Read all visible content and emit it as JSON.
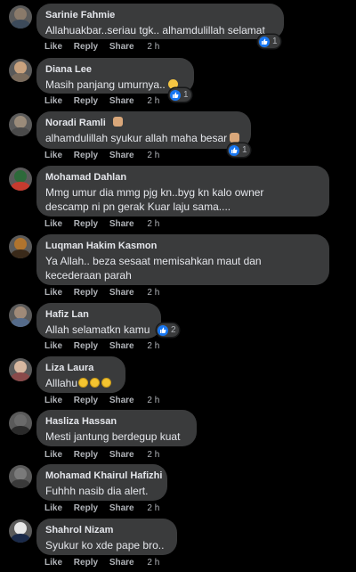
{
  "actions": {
    "like": "Like",
    "reply": "Reply",
    "share": "Share"
  },
  "colors": {
    "bubble": "#3a3b3c",
    "text": "#e4e6eb",
    "meta": "#b0b3b8",
    "like_blue": "#1877f2"
  },
  "comments": [
    {
      "name": "Sarinie Fahmie",
      "text": "Allahuakbar..seriau tgk.. alhamdulillah selamat",
      "time": "2 h",
      "reactions": "1"
    },
    {
      "name": "Diana Lee",
      "text": "Masih panjang umurnya..",
      "emoji": "raising-hands",
      "time": "2 h",
      "reactions": "1"
    },
    {
      "name": "Noradi Ramli",
      "name_emoji": "waving-hand",
      "text": "alhamdulillah syukur allah maha besar",
      "emoji": "ok-hand",
      "time": "2 h",
      "reactions": "1"
    },
    {
      "name": "Mohamad Dahlan",
      "text": "Mmg umur dia mmg pjg kn..byg kn kalo owner",
      "text2": "descamp ni pn gerak Kuar laju sama....",
      "time": "2 h"
    },
    {
      "name": "Luqman Hakim Kasmon",
      "text": "Ya Allah.. beza sesaat memisahkan maut dan",
      "text2": "kecederaan parah",
      "time": "2 h"
    },
    {
      "name": "Hafiz Lan",
      "text": "Allah selamatkn kamu",
      "time": "2 h",
      "reactions": "2"
    },
    {
      "name": "Liza Laura",
      "text": "Alllahu",
      "emoji": "sad-face x3",
      "time": "2 h"
    },
    {
      "name": "Hasliza Hassan",
      "text": "Mesti jantung berdegup kuat",
      "time": "2 h"
    },
    {
      "name": "Mohamad Khairul Hafizhi",
      "text": "Fuhhh nasib dia alert.",
      "time": "2 h"
    },
    {
      "name": "Shahrol Nizam",
      "text": "Syukur ko xde pape bro..",
      "time": "2 h"
    }
  ]
}
